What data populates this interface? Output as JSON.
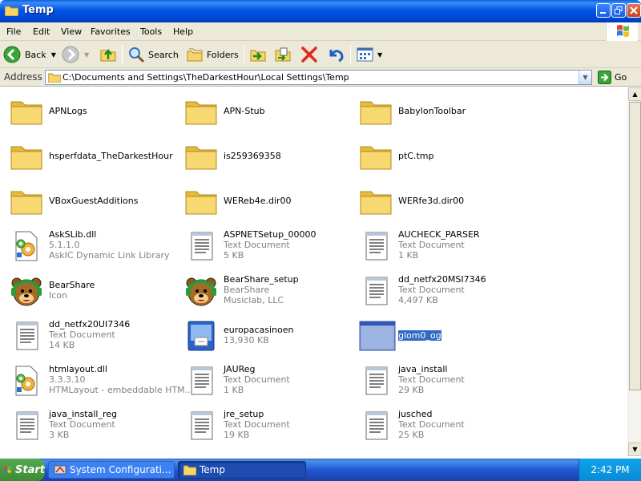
{
  "window": {
    "title": "Temp",
    "menu": [
      "File",
      "Edit",
      "View",
      "Favorites",
      "Tools",
      "Help"
    ]
  },
  "toolbar": {
    "back_label": "Back",
    "search_label": "Search",
    "folders_label": "Folders"
  },
  "address": {
    "label": "Address",
    "path": "C:\\Documents and Settings\\TheDarkestHour\\Local Settings\\Temp",
    "go_label": "Go"
  },
  "files": [
    {
      "name": "APNLogs",
      "type": "folder"
    },
    {
      "name": "APN-Stub",
      "type": "folder"
    },
    {
      "name": "BabylonToolbar",
      "type": "folder"
    },
    {
      "name": "hsperfdata_TheDarkestHour",
      "type": "folder"
    },
    {
      "name": "is259369358",
      "type": "folder"
    },
    {
      "name": "ptC.tmp",
      "type": "folder"
    },
    {
      "name": "VBoxGuestAdditions",
      "type": "folder"
    },
    {
      "name": "WEReb4e.dir00",
      "type": "folder"
    },
    {
      "name": "WERfe3d.dir00",
      "type": "folder"
    },
    {
      "name": "AskSLib.dll",
      "line2": "5.1.1.0",
      "line3": "AskIC Dynamic Link Library",
      "type": "dll"
    },
    {
      "name": "ASPNETSetup_00000",
      "line2": "Text Document",
      "line3": "5 KB",
      "type": "text"
    },
    {
      "name": "AUCHECK_PARSER",
      "line2": "Text Document",
      "line3": "1 KB",
      "type": "text"
    },
    {
      "name": "BearShare",
      "line2": "Icon",
      "type": "bear"
    },
    {
      "name": "BearShare_setup",
      "line2": "BearShare",
      "line3": "Musiclab, LLC",
      "type": "bear"
    },
    {
      "name": "dd_netfx20MSI7346",
      "line2": "Text Document",
      "line3": "4,497 KB",
      "type": "text"
    },
    {
      "name": "dd_netfx20UI7346",
      "line2": "Text Document",
      "line3": "14 KB",
      "type": "text"
    },
    {
      "name": "europacasinoen",
      "line2": "13,930 KB",
      "type": "installer"
    },
    {
      "name": "glom0_og",
      "type": "window",
      "selected": true
    },
    {
      "name": "htmlayout.dll",
      "line2": "3.3.3.10",
      "line3": "HTMLayout - embeddable HTM...",
      "type": "dll"
    },
    {
      "name": "JAUReg",
      "line2": "Text Document",
      "line3": "1 KB",
      "type": "text"
    },
    {
      "name": "java_install",
      "line2": "Text Document",
      "line3": "29 KB",
      "type": "text"
    },
    {
      "name": "java_install_reg",
      "line2": "Text Document",
      "line3": "3 KB",
      "type": "text"
    },
    {
      "name": "jre_setup",
      "line2": "Text Document",
      "line3": "19 KB",
      "type": "text"
    },
    {
      "name": "jusched",
      "line2": "Text Document",
      "line3": "25 KB",
      "type": "text"
    }
  ],
  "taskbar": {
    "start_label": "Start",
    "items": [
      "System Configurati...",
      "Temp"
    ],
    "clock": "2:42 PM"
  }
}
